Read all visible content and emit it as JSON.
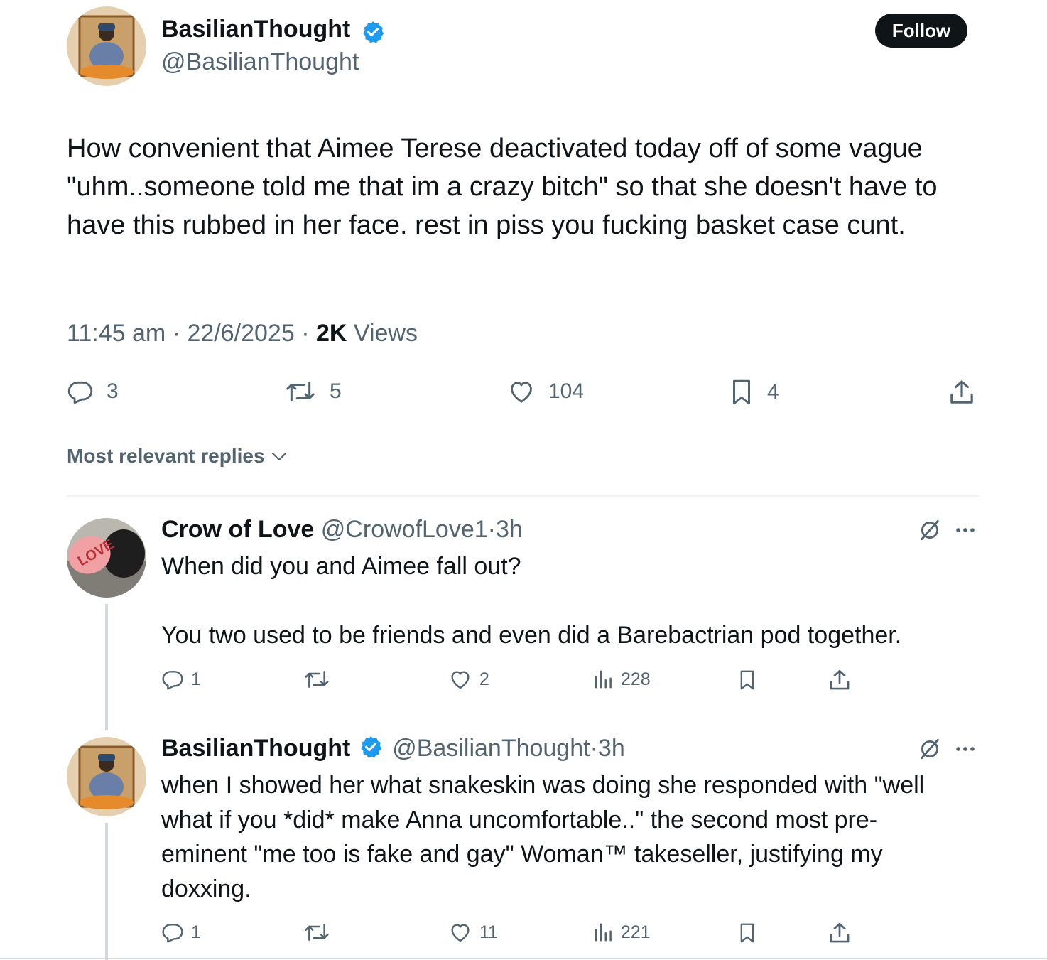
{
  "main_tweet": {
    "display_name": "BasilianThought",
    "handle": "@BasilianThought",
    "follow_label": "Follow",
    "text": "How convenient that Aimee Terese deactivated today off of some vague \"uhm..someone told me that im a crazy bitch\" so that she doesn't have to have this rubbed in her face. rest in piss you fucking basket case cunt.",
    "time": "11:45 am",
    "sep": "·",
    "date": "22/6/2025",
    "views_count": "2K",
    "views_label": "Views",
    "replies": "3",
    "reposts": "5",
    "likes": "104",
    "bookmarks": "4"
  },
  "sort_label": "Most relevant replies",
  "replies": [
    {
      "display_name": "Crow of Love",
      "handle": "@CrowofLove1",
      "sep": "·",
      "time": "3h",
      "text_line1": "When did you and Aimee fall out?",
      "text_line2": "You two used to be friends and even did a Barebactrian pod together.",
      "reply_count": "1",
      "like_count": "2",
      "view_count": "228"
    },
    {
      "display_name": "BasilianThought",
      "handle": "@BasilianThought",
      "sep": "·",
      "time": "3h",
      "text": "when I showed her what snakeskin was doing she responded with \"well what if you *did* make Anna uncomfortable..\" the second most pre-eminent \"me too is fake and gay\" Woman™ takeseller, justifying my doxxing.",
      "reply_count": "1",
      "like_count": "11",
      "view_count": "221"
    }
  ],
  "colors": {
    "accent": "#1d9bf0",
    "verified": "#1d9bf0",
    "text": "#0f1419",
    "secondary": "#536471"
  },
  "icons": [
    "verified-badge-icon",
    "reply-icon",
    "repost-icon",
    "like-icon",
    "bookmark-icon",
    "share-icon",
    "views-icon",
    "grok-icon",
    "more-icon",
    "chevron-down-icon"
  ]
}
